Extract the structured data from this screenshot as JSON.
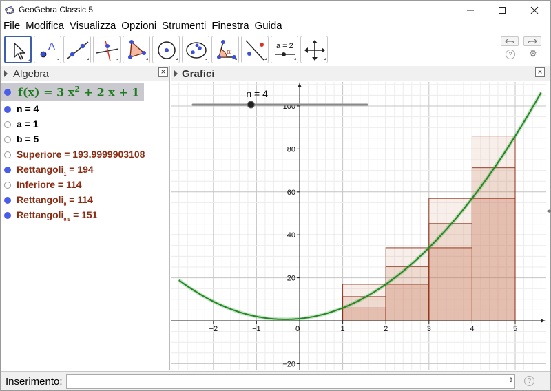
{
  "window": {
    "title": "GeoGebra Classic 5"
  },
  "menu": [
    "File",
    "Modifica",
    "Visualizza",
    "Opzioni",
    "Strumenti",
    "Finestra",
    "Guida"
  ],
  "toolbar": {
    "tools": [
      {
        "name": "move-tool",
        "active": true
      },
      {
        "name": "point-tool",
        "label": "A"
      },
      {
        "name": "line-tool"
      },
      {
        "name": "perpendicular-line-tool"
      },
      {
        "name": "polygon-tool"
      },
      {
        "name": "circle-tool"
      },
      {
        "name": "ellipse-tool"
      },
      {
        "name": "angle-tool",
        "label": "α"
      },
      {
        "name": "reflect-tool"
      },
      {
        "name": "slider-tool",
        "label": "a = 2"
      },
      {
        "name": "move-graphics-view-tool"
      }
    ]
  },
  "algebra": {
    "title": "Algebra",
    "function": "f(x) = 3x² + 2x + 1",
    "items": [
      {
        "text": "n = 4",
        "visible": true,
        "color": "#000000"
      },
      {
        "text": "a = 1",
        "visible": false,
        "color": "#000000"
      },
      {
        "text": "b = 5",
        "visible": false,
        "color": "#000000"
      },
      {
        "text": "Superiore = 193.9999903108",
        "visible": false,
        "color": "#8b2c12"
      },
      {
        "text": "Rettangoli",
        "sub": "1",
        "value": " = 194",
        "visible": true,
        "color": "#8b2c12"
      },
      {
        "text": "Inferiore = 114",
        "visible": false,
        "color": "#8b2c12"
      },
      {
        "text": "Rettangoli",
        "sub": "0",
        "value": " = 114",
        "visible": true,
        "color": "#8b2c12"
      },
      {
        "text": "Rettangoli",
        "sub": "0.5",
        "value": " = 151",
        "visible": true,
        "color": "#8b2c12"
      }
    ]
  },
  "graphics": {
    "title": "Grafici",
    "slider_label": "n = 4",
    "x_ticks": [
      "−2",
      "−1",
      "0",
      "1",
      "2",
      "3",
      "4",
      "5"
    ],
    "y_ticks": [
      "100",
      "80",
      "60",
      "40",
      "20",
      "−20"
    ]
  },
  "chart_data": {
    "type": "line",
    "function": "3x^2 + 2x + 1",
    "xlim": [
      -2.8,
      5.6
    ],
    "ylim": [
      -25,
      110
    ],
    "grid": true,
    "slider": {
      "name": "n",
      "value": 4,
      "min": 1,
      "max": 10
    },
    "rectangles": {
      "x_edges": [
        1,
        2,
        3,
        4,
        5
      ],
      "upper": [
        17,
        34,
        57,
        86
      ],
      "midpoint": [
        11.25,
        25.25,
        45.25,
        71.25
      ],
      "lower": [
        6,
        17,
        34,
        57
      ]
    },
    "colors": {
      "curve": "#1f8a1f",
      "rect": "#8b2c12"
    }
  },
  "input": {
    "label": "Inserimento:",
    "value": ""
  }
}
